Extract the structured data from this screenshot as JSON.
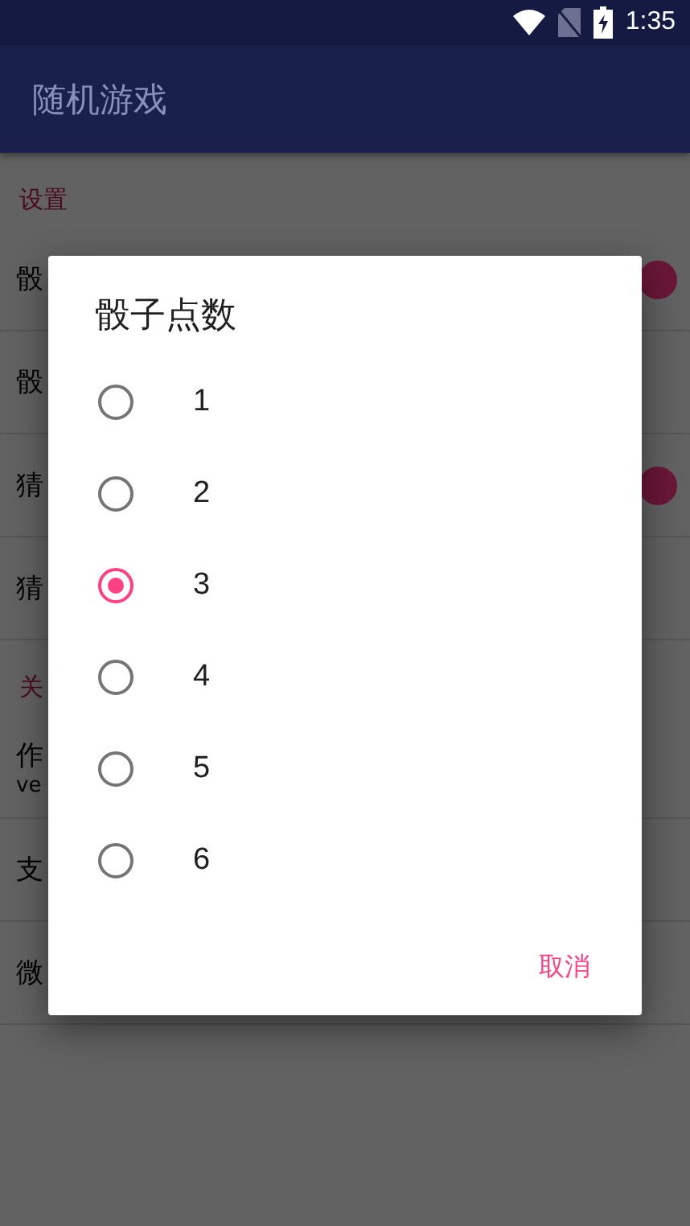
{
  "status_bar": {
    "time": "1:35"
  },
  "app_bar": {
    "title": "随机游戏"
  },
  "sections": [
    {
      "header": "设置",
      "items": [
        {
          "kind": "switch",
          "title": "骰",
          "on": true
        },
        {
          "kind": "plain",
          "title": "骰"
        },
        {
          "kind": "switch",
          "title": "猜",
          "on": true
        },
        {
          "kind": "plain",
          "title": "猜"
        }
      ]
    },
    {
      "header": "关",
      "items": [
        {
          "kind": "plain",
          "title": "作",
          "subtitle": "ve"
        },
        {
          "kind": "plain",
          "title": "支"
        },
        {
          "kind": "plain",
          "title": "微"
        }
      ]
    }
  ],
  "dialog": {
    "title": "骰子点数",
    "options": [
      {
        "label": "1",
        "selected": false
      },
      {
        "label": "2",
        "selected": false
      },
      {
        "label": "3",
        "selected": true
      },
      {
        "label": "4",
        "selected": false
      },
      {
        "label": "5",
        "selected": false
      },
      {
        "label": "6",
        "selected": false
      }
    ],
    "button": "取消"
  }
}
